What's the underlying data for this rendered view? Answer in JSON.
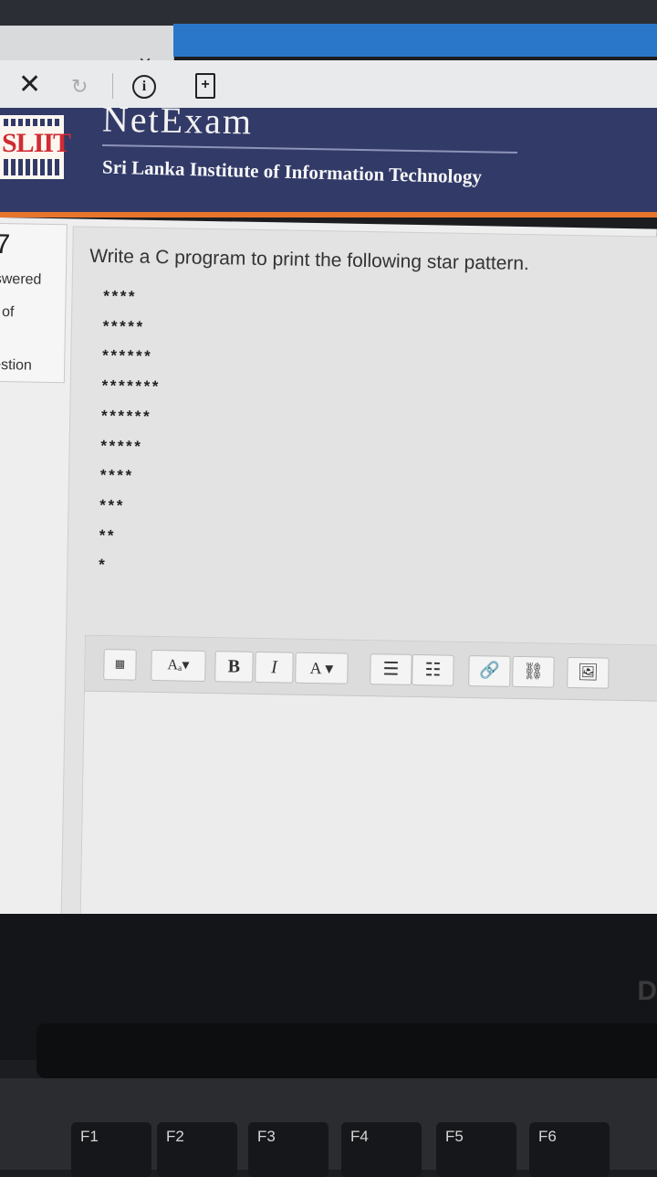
{
  "browser": {
    "tab_close_glyph": "×",
    "toolbar": {
      "close_glyph": "✕",
      "refresh_glyph": "↻",
      "info_glyph": "i",
      "page_glyph": "+"
    }
  },
  "header": {
    "logo_text": "SLIIT",
    "brand": "NetExam",
    "institute": "Sri Lanka Institute of Information Technology",
    "colors": {
      "band": "#323a68",
      "accent": "#e8752d",
      "logo_red": "#d12b34"
    }
  },
  "sidebar": {
    "question_number": "7",
    "status": "swered",
    "marks": "t of",
    "flag": "estion"
  },
  "question": {
    "text": "Write a C program to print the following star pattern.",
    "pattern": "****\n*****\n******\n*******\n******\n*****\n****\n***\n**\n*"
  },
  "editor": {
    "toolbar": {
      "kitchen_sink": "▦",
      "paragraph": "Aₐ▾",
      "bold": "B",
      "italic": "I",
      "font_color": "A ▾",
      "bullet_list": "☰",
      "numbered_list": "☷",
      "link": "🔗",
      "unlink": "⛓",
      "image": "🖼"
    }
  },
  "keyboard": {
    "keys": [
      "F1",
      "F2",
      "F3",
      "F4",
      "F5",
      "F6"
    ]
  }
}
